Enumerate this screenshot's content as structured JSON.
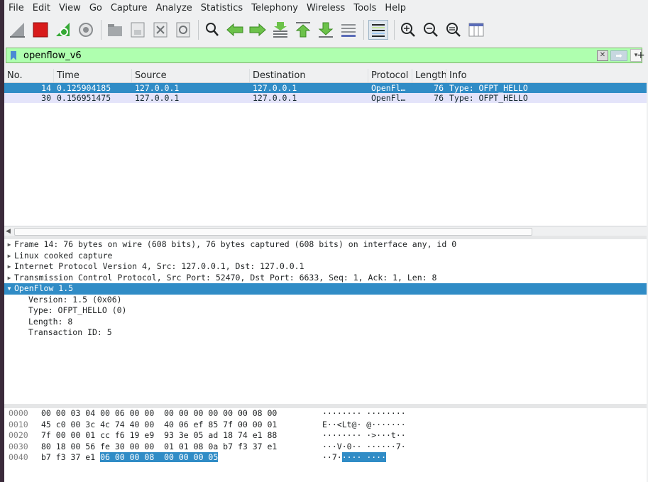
{
  "menu": [
    "File",
    "Edit",
    "View",
    "Go",
    "Capture",
    "Analyze",
    "Statistics",
    "Telephony",
    "Wireless",
    "Tools",
    "Help"
  ],
  "toolbar_icons": [
    "shark-fin-start-icon",
    "stop-capture-icon",
    "restart-capture-icon",
    "capture-options-icon",
    "open-file-icon",
    "save-file-icon",
    "close-file-icon",
    "reload-file-icon",
    "find-packet-icon",
    "go-back-icon",
    "go-forward-icon",
    "go-to-packet-icon",
    "go-first-icon",
    "go-last-icon",
    "autoscroll-icon",
    "colorize-icon",
    "zoom-in-icon",
    "zoom-out-icon",
    "zoom-normal-icon",
    "resize-columns-icon"
  ],
  "filter": {
    "value": "openflow_v6",
    "plus": "+"
  },
  "packet_list": {
    "columns": [
      "No.",
      "Time",
      "Source",
      "Destination",
      "Protocol",
      "Length",
      "Info"
    ],
    "rows": [
      {
        "no": "14",
        "time": "0.125904185",
        "source": "127.0.0.1",
        "destination": "127.0.0.1",
        "protocol": "OpenFl…",
        "length": "76",
        "info": "Type: OFPT_HELLO"
      },
      {
        "no": "30",
        "time": "0.156951475",
        "source": "127.0.0.1",
        "destination": "127.0.0.1",
        "protocol": "OpenFl…",
        "length": "76",
        "info": "Type: OFPT_HELLO"
      }
    ]
  },
  "details": {
    "tree": [
      {
        "text": "Frame 14: 76 bytes on wire (608 bits), 76 bytes captured (608 bits) on interface any, id 0",
        "expanded": false
      },
      {
        "text": "Linux cooked capture",
        "expanded": false
      },
      {
        "text": "Internet Protocol Version 4, Src: 127.0.0.1, Dst: 127.0.0.1",
        "expanded": false
      },
      {
        "text": "Transmission Control Protocol, Src Port: 52470, Dst Port: 6633, Seq: 1, Ack: 1, Len: 8",
        "expanded": false
      },
      {
        "text": "OpenFlow 1.5",
        "expanded": true
      }
    ],
    "children": [
      "Version: 1.5 (0x06)",
      "Type: OFPT_HELLO (0)",
      "Length: 8",
      "Transaction ID: 5"
    ]
  },
  "bytes": [
    {
      "offset": "0000",
      "hex": "00 00 03 04 00 06 00 00  00 00 00 00 00 00 08 00",
      "ascii": "········ ········"
    },
    {
      "offset": "0010",
      "hex": "45 c0 00 3c 4c 74 40 00  40 06 ef 85 7f 00 00 01",
      "ascii": "E··<Lt@· @·······"
    },
    {
      "offset": "0020",
      "hex": "7f 00 00 01 cc f6 19 e9  93 3e 05 ad 18 74 e1 88",
      "ascii": "········ ·>···t··"
    },
    {
      "offset": "0030",
      "hex": "80 18 00 56 fe 30 00 00  01 01 08 0a b7 f3 37 e1",
      "ascii": "···V·0·· ······7·"
    },
    {
      "offset": "0040",
      "hex_plain": "b7 f3 37 e1 ",
      "hex_sel": "06 00 00 08  00 00 00 05",
      "ascii_plain": "··7·",
      "ascii_sel": "···· ····"
    }
  ],
  "colors": {
    "selection": "#308cc6",
    "alt_row": "#e4e4fa",
    "filter_bg": "#afffaf"
  }
}
